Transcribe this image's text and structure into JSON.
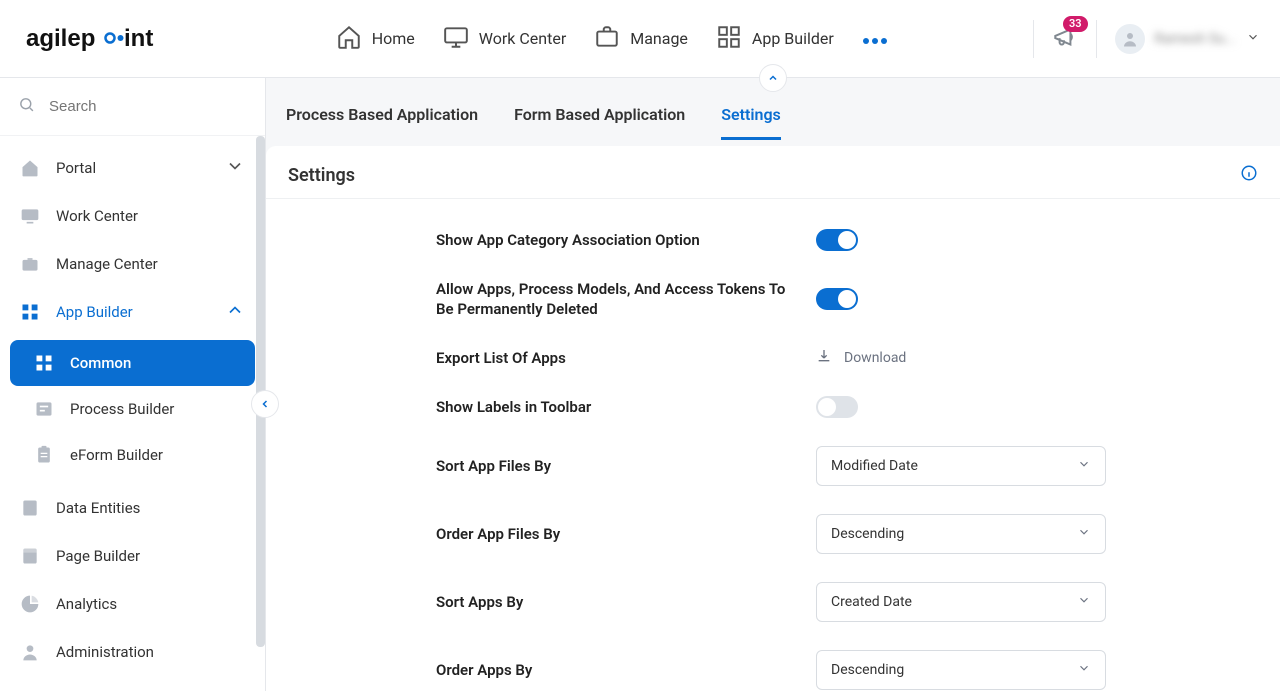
{
  "brand": "agilepoint",
  "header": {
    "nav": [
      {
        "id": "home",
        "label": "Home"
      },
      {
        "id": "work-center",
        "label": "Work Center"
      },
      {
        "id": "manage",
        "label": "Manage"
      },
      {
        "id": "app-builder",
        "label": "App Builder"
      }
    ],
    "notif_count": "33",
    "user_name": "Ramesh Su..."
  },
  "sidebar": {
    "search_placeholder": "Search",
    "items": {
      "portal": "Portal",
      "work_center": "Work Center",
      "manage_center": "Manage Center",
      "app_builder": "App Builder",
      "common": "Common",
      "process_builder": "Process Builder",
      "eform_builder": "eForm Builder",
      "data_entities": "Data Entities",
      "page_builder": "Page Builder",
      "analytics": "Analytics",
      "administration": "Administration"
    }
  },
  "tabs": {
    "process_app": "Process Based Application",
    "form_app": "Form Based Application",
    "settings": "Settings"
  },
  "panel": {
    "title": "Settings"
  },
  "settings": {
    "show_category": {
      "label": "Show App Category Association Option",
      "value": true
    },
    "allow_permanent_delete": {
      "label": "Allow Apps, Process Models, And Access Tokens To Be Permanently Deleted",
      "value": true
    },
    "export_apps": {
      "label": "Export List Of Apps",
      "action": "Download"
    },
    "show_labels_toolbar": {
      "label": "Show Labels in Toolbar",
      "value": false
    },
    "sort_app_files": {
      "label": "Sort App Files By",
      "value": "Modified Date"
    },
    "order_app_files": {
      "label": "Order App Files By",
      "value": "Descending"
    },
    "sort_apps": {
      "label": "Sort Apps By",
      "value": "Created Date"
    },
    "order_apps": {
      "label": "Order Apps By",
      "value": "Descending"
    }
  }
}
